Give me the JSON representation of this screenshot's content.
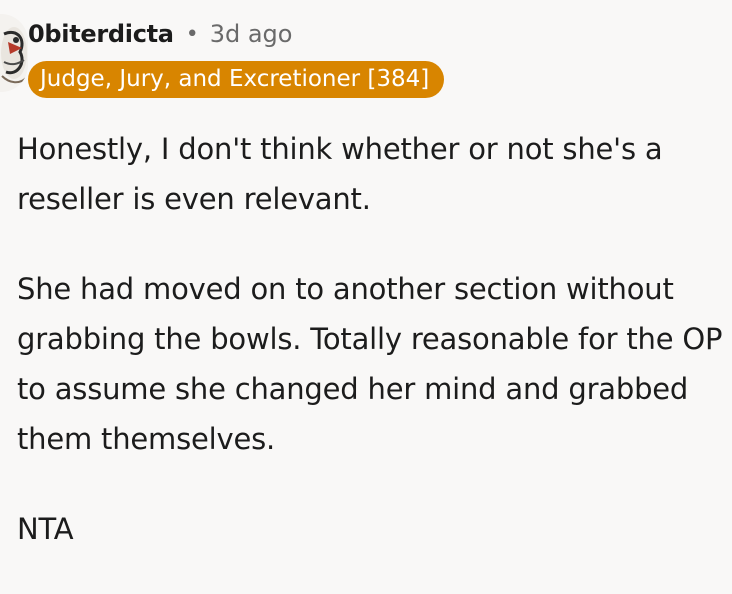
{
  "comment": {
    "author": "0biterdicta",
    "separator": "•",
    "timestamp": "3d ago",
    "flair": "Judge, Jury, and Excretioner [384]",
    "paragraphs": [
      "Honestly, I don't think whether or not she's a reseller is even relevant.",
      "She had moved on to another section without grabbing the bowls. Totally reasonable for the OP to assume she changed her mind and grabbed them themselves.",
      "NTA"
    ]
  },
  "colors": {
    "flair_background": "#d88500",
    "flair_text": "#ffffff",
    "username": "#1c1c1c",
    "muted": "#6a6a6a",
    "page_background": "#f9f8f7"
  },
  "icons": {
    "avatar": "user-avatar-icon"
  }
}
